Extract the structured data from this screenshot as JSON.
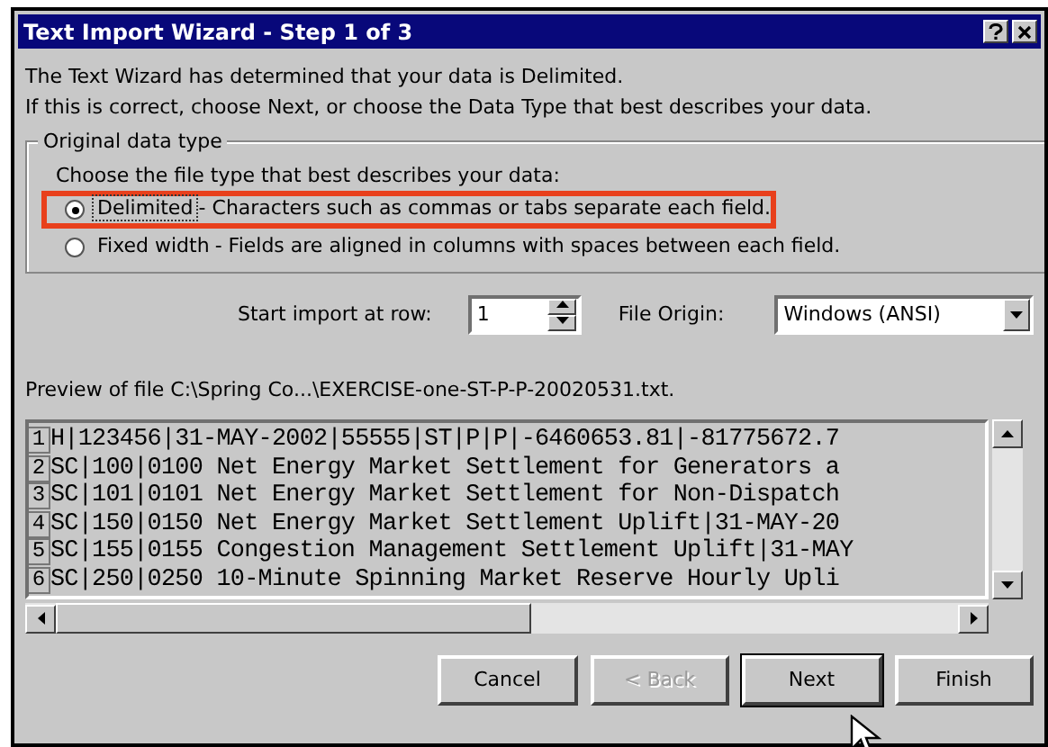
{
  "window": {
    "title": "Text Import Wizard - Step 1 of 3"
  },
  "intro": [
    "The Text Wizard has determined that your data is Delimited.",
    "If this is correct, choose Next, or choose the Data Type that best describes your data."
  ],
  "group": {
    "legend": "Original data type",
    "prompt": "Choose the file type that best describes your data:",
    "options": [
      {
        "label": "Delimited",
        "description": "- Characters such as commas or tabs separate each field.",
        "selected": true,
        "focused": true,
        "highlighted": true
      },
      {
        "label": "Fixed width",
        "description": "- Fields are aligned in columns with spaces between each field.",
        "selected": false,
        "focused": false,
        "highlighted": false
      }
    ]
  },
  "start_row": {
    "label": "Start import at row:",
    "value": "1"
  },
  "file_origin": {
    "label": "File Origin:",
    "value": "Windows (ANSI)"
  },
  "preview": {
    "label": "Preview of file C:\\Spring Co...\\EXERCISE-one-ST-P-P-20020531.txt.",
    "rows": [
      {
        "number": "1",
        "text": "H|123456|31-MAY-2002|55555|ST|P|P|-6460653.81|-81775672.7"
      },
      {
        "number": "2",
        "text": "SC|100|0100 Net Energy Market Settlement for Generators a"
      },
      {
        "number": "3",
        "text": "SC|101|0101 Net Energy Market Settlement for Non-Dispatch"
      },
      {
        "number": "4",
        "text": "SC|150|0150 Net Energy Market Settlement Uplift|31-MAY-20"
      },
      {
        "number": "5",
        "text": "SC|155|0155 Congestion Management Settlement Uplift|31-MAY"
      },
      {
        "number": "6",
        "text": "SC|250|0250 10-Minute Spinning Market Reserve Hourly Upli"
      }
    ]
  },
  "buttons": [
    {
      "label": "Cancel",
      "disabled": false,
      "focused": false
    },
    {
      "label": "< Back",
      "disabled": true,
      "focused": false
    },
    {
      "label": "Next",
      "disabled": false,
      "focused": true
    },
    {
      "label": "Finish",
      "disabled": false,
      "focused": false
    }
  ]
}
